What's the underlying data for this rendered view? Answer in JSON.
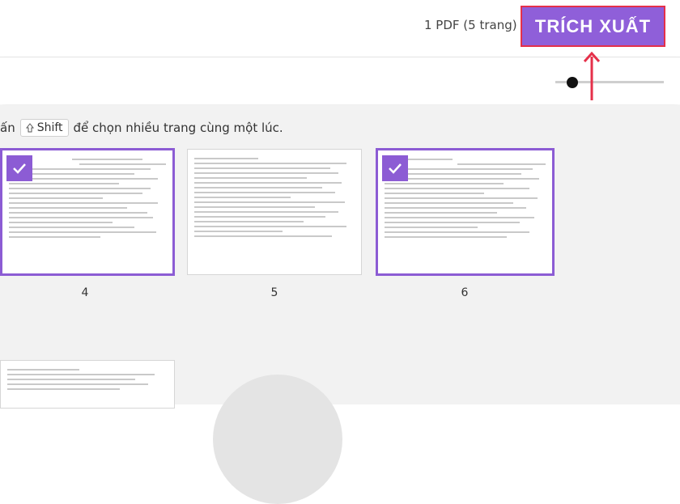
{
  "header": {
    "pdf_count": "1 PDF (5 trang)",
    "extract_label": "TRÍCH XUẤT"
  },
  "hint": {
    "prefix": "ấn",
    "key_label": "Shift",
    "suffix": "để chọn nhiều trang cùng một lúc."
  },
  "pages": [
    {
      "number": "4",
      "selected": true
    },
    {
      "number": "5",
      "selected": false
    },
    {
      "number": "6",
      "selected": true
    }
  ],
  "colors": {
    "accent": "#8f5fd9",
    "highlight_border": "#e5304a"
  }
}
